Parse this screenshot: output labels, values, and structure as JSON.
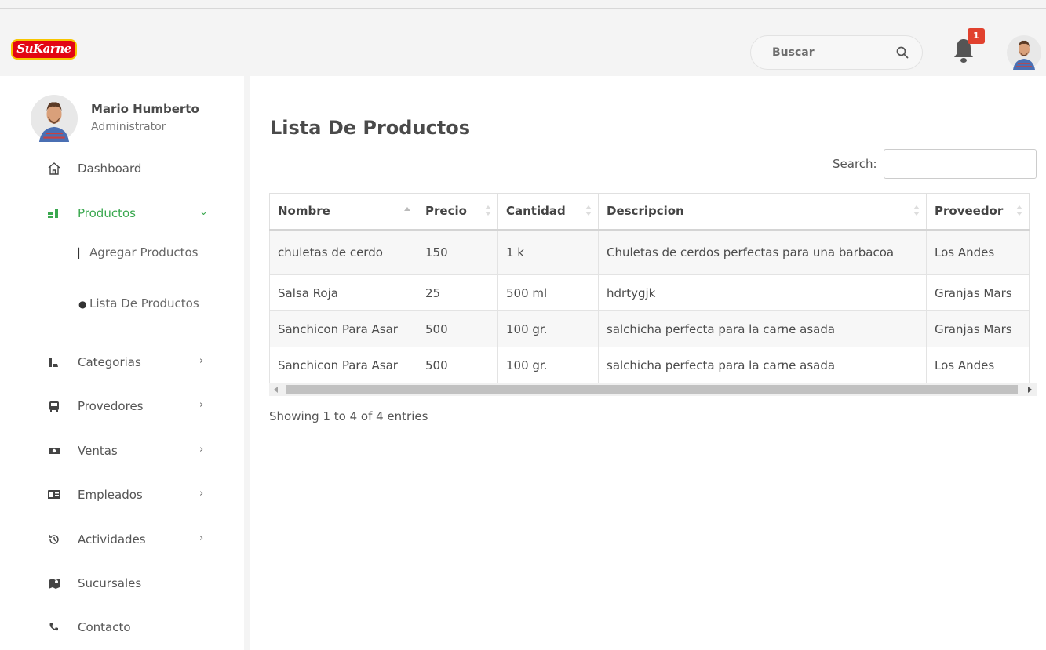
{
  "brand": {
    "logo_text": "SuKarne"
  },
  "topbar": {
    "search_label": "Buscar",
    "notification_count": "1"
  },
  "sidebar": {
    "user": {
      "name": "Mario Humberto",
      "role": "Administrator"
    },
    "items": [
      {
        "label": "Dashboard",
        "icon": "home-icon"
      },
      {
        "label": "Productos",
        "icon": "products-icon",
        "active": true,
        "expanded": true
      },
      {
        "label": "Categorias",
        "icon": "boots-icon"
      },
      {
        "label": "Provedores",
        "icon": "bus-icon"
      },
      {
        "label": "Ventas",
        "icon": "money-icon"
      },
      {
        "label": "Empleados",
        "icon": "id-card-icon"
      },
      {
        "label": "Actividades",
        "icon": "history-icon"
      },
      {
        "label": "Sucursales",
        "icon": "map-icon"
      },
      {
        "label": "Contacto",
        "icon": "phone-icon"
      }
    ],
    "subitems": [
      {
        "label": "Agregar Productos",
        "icon": "boots-icon"
      },
      {
        "label": "Lista De Productos",
        "icon": "apple-icon"
      }
    ]
  },
  "main": {
    "title": "Lista De Productos",
    "search_label": "Search:",
    "search_value": "",
    "columns": [
      "Nombre",
      "Precio",
      "Cantidad",
      "Descripcion",
      "Proveedor"
    ],
    "rows": [
      [
        "chuletas de cerdo",
        "150",
        "1 k",
        "Chuletas de cerdos perfectas para una barbacoa",
        "Los Andes"
      ],
      [
        "Salsa Roja",
        "25",
        "500 ml",
        "hdrtygjk",
        "Granjas Mars"
      ],
      [
        "Sanchicon Para Asar",
        "500",
        "100 gr.",
        "salchicha perfecta para la carne asada",
        "Granjas Mars"
      ],
      [
        "Sanchicon Para Asar",
        "500",
        "100 gr.",
        "salchicha perfecta para la carne asada",
        "Los Andes"
      ]
    ],
    "info": "Showing 1 to 4 of 4 entries"
  },
  "colors": {
    "accent_green": "#3aa84f",
    "badge_red": "#e1412e",
    "logo_red": "#e30613"
  }
}
